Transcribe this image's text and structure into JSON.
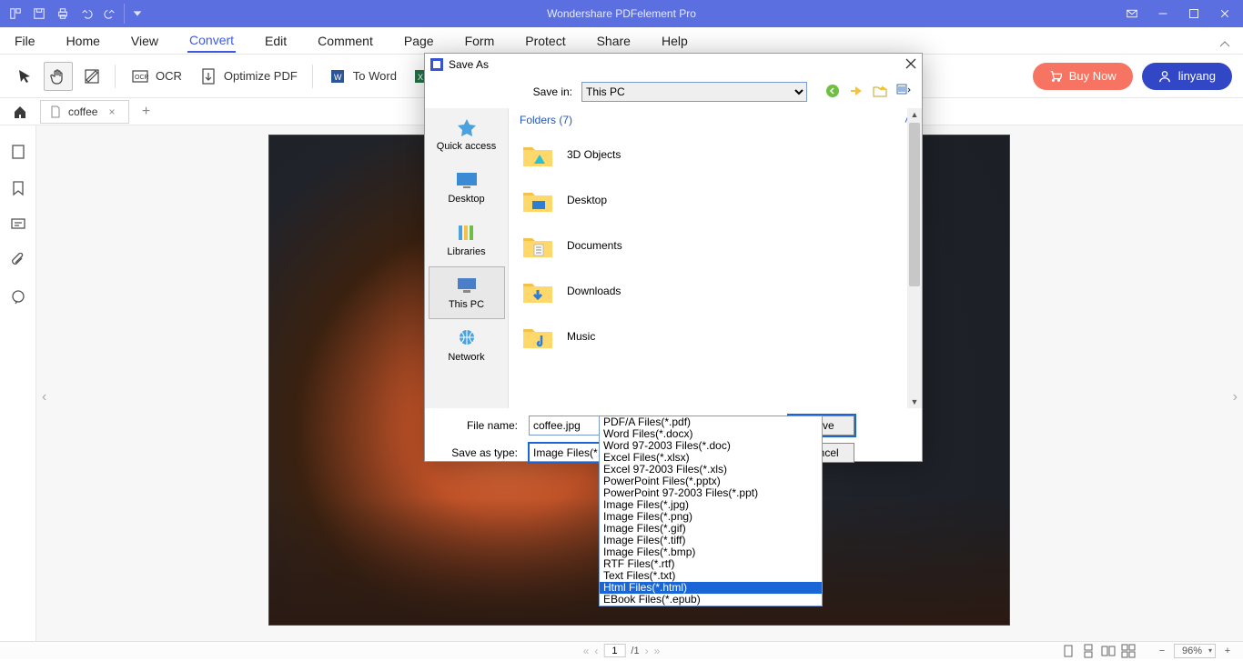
{
  "titlebar": {
    "title": "Wondershare PDFelement Pro"
  },
  "menus": [
    "File",
    "Home",
    "View",
    "Convert",
    "Edit",
    "Comment",
    "Page",
    "Form",
    "Protect",
    "Share",
    "Help"
  ],
  "active_menu_index": 3,
  "toolbar": {
    "ocr": "OCR",
    "optimize": "Optimize PDF",
    "toword": "To Word",
    "buy": "Buy Now",
    "user": "linyang"
  },
  "tab": {
    "doc_name": "coffee",
    "plus": "+",
    "close": "×"
  },
  "statusbar": {
    "page_current": "1",
    "page_total": "/1",
    "zoom": "96%"
  },
  "dialog": {
    "title": "Save As",
    "savein_label": "Save in:",
    "savein_value": "This PC",
    "places": [
      "Quick access",
      "Desktop",
      "Libraries",
      "This PC",
      "Network"
    ],
    "selected_place_index": 3,
    "folders_header": "Folders (7)",
    "folders": [
      "3D Objects",
      "Desktop",
      "Documents",
      "Downloads",
      "Music"
    ],
    "filename_label": "File name:",
    "filename_value": "coffee.jpg",
    "type_label": "Save as type:",
    "type_value": "Image Files(*.jpg)",
    "save_btn": "Save",
    "cancel_btn": "Cancel",
    "type_options": [
      "PDF/A Files(*.pdf)",
      "Word Files(*.docx)",
      "Word 97-2003 Files(*.doc)",
      "Excel Files(*.xlsx)",
      "Excel 97-2003 Files(*.xls)",
      "PowerPoint Files(*.pptx)",
      "PowerPoint 97-2003 Files(*.ppt)",
      "Image Files(*.jpg)",
      "Image Files(*.png)",
      "Image Files(*.gif)",
      "Image Files(*.tiff)",
      "Image Files(*.bmp)",
      "RTF Files(*.rtf)",
      "Text Files(*.txt)",
      "Html Files(*.html)",
      "EBook Files(*.epub)"
    ],
    "highlighted_option_index": 14
  }
}
